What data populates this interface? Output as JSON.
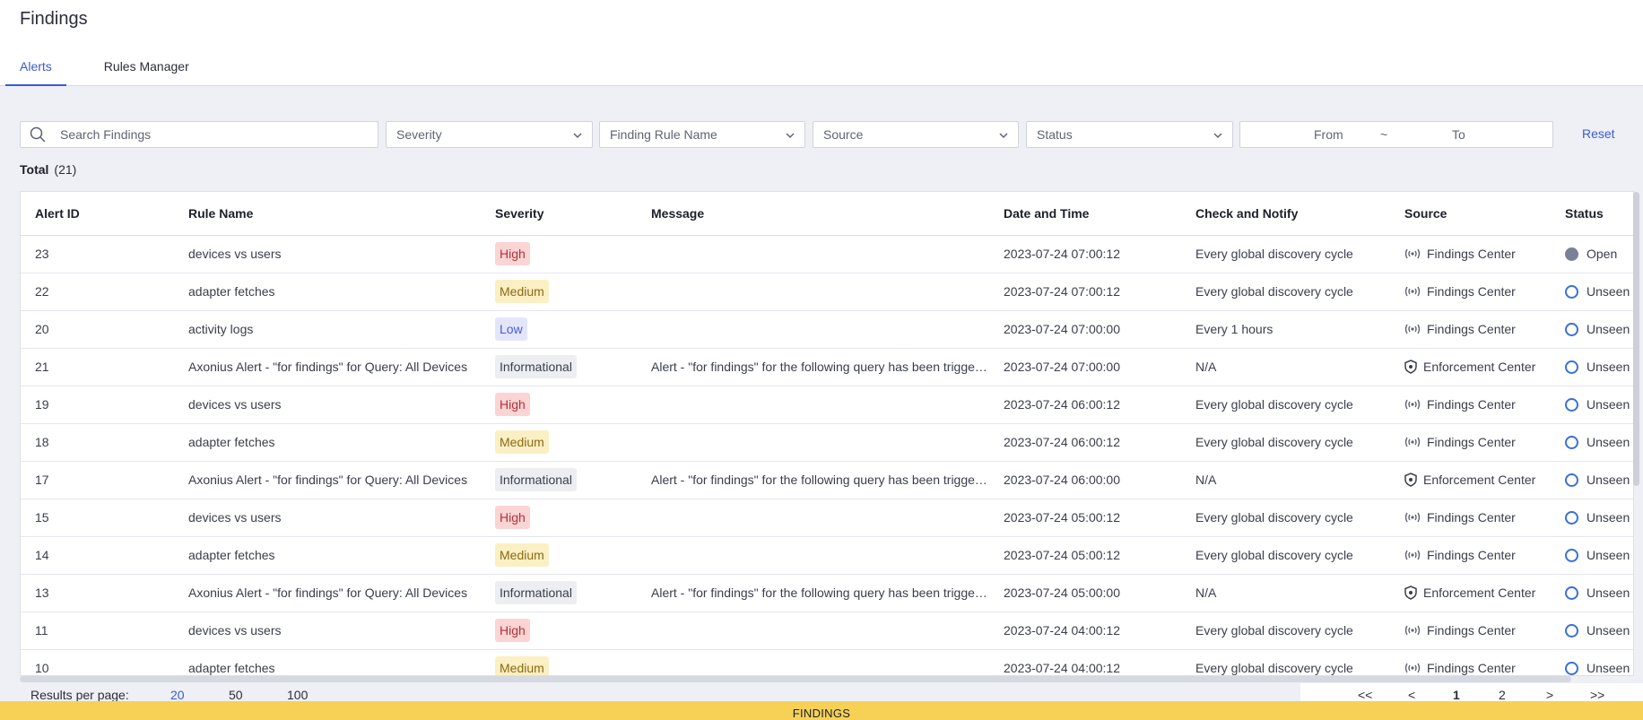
{
  "page": {
    "title": "Findings"
  },
  "tabs": [
    {
      "label": "Alerts",
      "active": true
    },
    {
      "label": "Rules Manager",
      "active": false
    }
  ],
  "filters": {
    "search_placeholder": "Search Findings",
    "severity": "Severity",
    "rule_name": "Finding Rule Name",
    "source": "Source",
    "status": "Status",
    "date_from": "From",
    "date_sep": "~",
    "date_to": "To",
    "reset": "Reset"
  },
  "total": {
    "label": "Total",
    "count": "(21)"
  },
  "table": {
    "columns": [
      "Alert ID",
      "Rule Name",
      "Severity",
      "Message",
      "Date and Time",
      "Check and Notify",
      "Source",
      "Status"
    ],
    "rows": [
      {
        "id": "23",
        "rule": "devices vs users",
        "severity": "High",
        "message": "",
        "datetime": "2023-07-24 07:00:12",
        "notify": "Every global discovery cycle",
        "source": "Findings Center",
        "source_icon": "broadcast-icon",
        "status": "Open"
      },
      {
        "id": "22",
        "rule": "adapter fetches",
        "severity": "Medium",
        "message": "",
        "datetime": "2023-07-24 07:00:12",
        "notify": "Every global discovery cycle",
        "source": "Findings Center",
        "source_icon": "broadcast-icon",
        "status": "Unseen"
      },
      {
        "id": "20",
        "rule": "activity logs",
        "severity": "Low",
        "message": "",
        "datetime": "2023-07-24 07:00:00",
        "notify": "Every 1 hours",
        "source": "Findings Center",
        "source_icon": "broadcast-icon",
        "status": "Unseen"
      },
      {
        "id": "21",
        "rule": "Axonius Alert - \"for findings\" for Query: All Devices",
        "severity": "Informational",
        "message": "Alert - \"for findings\" for the following query has been triggered",
        "datetime": "2023-07-24 07:00:00",
        "notify": "N/A",
        "source": "Enforcement Center",
        "source_icon": "shield-icon",
        "status": "Unseen"
      },
      {
        "id": "19",
        "rule": "devices vs users",
        "severity": "High",
        "message": "",
        "datetime": "2023-07-24 06:00:12",
        "notify": "Every global discovery cycle",
        "source": "Findings Center",
        "source_icon": "broadcast-icon",
        "status": "Unseen"
      },
      {
        "id": "18",
        "rule": "adapter fetches",
        "severity": "Medium",
        "message": "",
        "datetime": "2023-07-24 06:00:12",
        "notify": "Every global discovery cycle",
        "source": "Findings Center",
        "source_icon": "broadcast-icon",
        "status": "Unseen"
      },
      {
        "id": "17",
        "rule": "Axonius Alert - \"for findings\" for Query: All Devices",
        "severity": "Informational",
        "message": "Alert - \"for findings\" for the following query has been triggered",
        "datetime": "2023-07-24 06:00:00",
        "notify": "N/A",
        "source": "Enforcement Center",
        "source_icon": "shield-icon",
        "status": "Unseen"
      },
      {
        "id": "15",
        "rule": "devices vs users",
        "severity": "High",
        "message": "",
        "datetime": "2023-07-24 05:00:12",
        "notify": "Every global discovery cycle",
        "source": "Findings Center",
        "source_icon": "broadcast-icon",
        "status": "Unseen"
      },
      {
        "id": "14",
        "rule": "adapter fetches",
        "severity": "Medium",
        "message": "",
        "datetime": "2023-07-24 05:00:12",
        "notify": "Every global discovery cycle",
        "source": "Findings Center",
        "source_icon": "broadcast-icon",
        "status": "Unseen"
      },
      {
        "id": "13",
        "rule": "Axonius Alert - \"for findings\" for Query: All Devices",
        "severity": "Informational",
        "message": "Alert - \"for findings\" for the following query has been triggered",
        "datetime": "2023-07-24 05:00:00",
        "notify": "N/A",
        "source": "Enforcement Center",
        "source_icon": "shield-icon",
        "status": "Unseen"
      },
      {
        "id": "11",
        "rule": "devices vs users",
        "severity": "High",
        "message": "",
        "datetime": "2023-07-24 04:00:12",
        "notify": "Every global discovery cycle",
        "source": "Findings Center",
        "source_icon": "broadcast-icon",
        "status": "Unseen"
      },
      {
        "id": "10",
        "rule": "adapter fetches",
        "severity": "Medium",
        "message": "",
        "datetime": "2023-07-24 04:00:12",
        "notify": "Every global discovery cycle",
        "source": "Findings Center",
        "source_icon": "broadcast-icon",
        "status": "Unseen"
      }
    ]
  },
  "severity_colors": {
    "High": {
      "bg": "#fbd4d4",
      "fg": "#b3313a"
    },
    "Medium": {
      "bg": "#fbefc4",
      "fg": "#8a6a12"
    },
    "Low": {
      "bg": "#e3e6fb",
      "fg": "#4a5ad0"
    },
    "Informational": {
      "bg": "#eceef2",
      "fg": "#3a3e4a"
    }
  },
  "footer": {
    "results_per_page_label": "Results per page:",
    "page_sizes": [
      "20",
      "50",
      "100"
    ],
    "pagination": {
      "first": "<<",
      "prev": "<",
      "pages": [
        "1",
        "2"
      ],
      "next": ">",
      "last": ">>"
    }
  },
  "banner": "FINDINGS"
}
